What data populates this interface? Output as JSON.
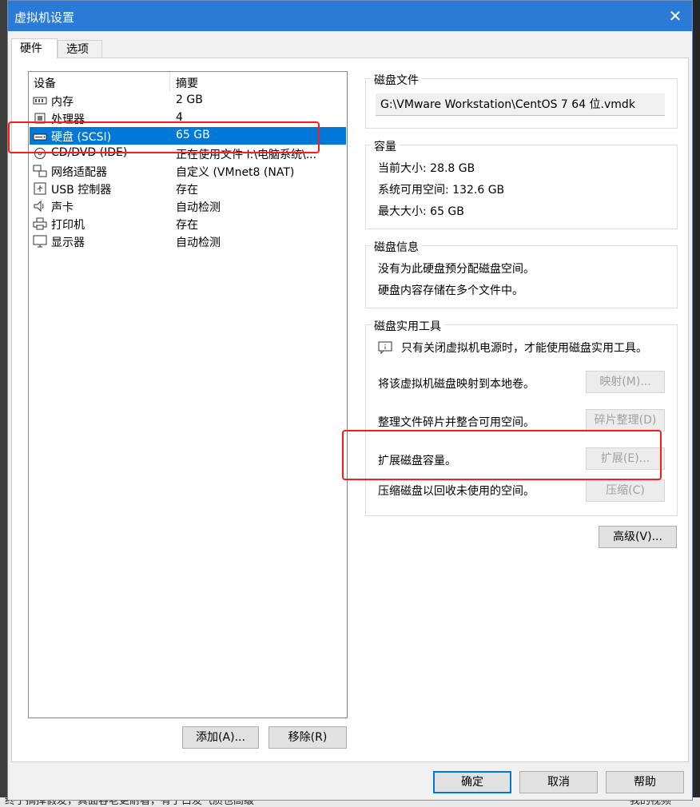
{
  "background": {
    "bottom_left_text": "终于摘掉假发，真面容老更耐看，有了白发气质也高级",
    "bottom_right_text": "我的视频"
  },
  "window": {
    "title": "虚拟机设置",
    "close_icon": "close-icon"
  },
  "tabs": [
    {
      "label": "硬件",
      "active": true
    },
    {
      "label": "选项",
      "active": false
    }
  ],
  "device_list": {
    "col_device": "设备",
    "col_summary": "摘要",
    "items": [
      {
        "icon": "memory-icon",
        "name": "内存",
        "summary": "2 GB"
      },
      {
        "icon": "processor-icon",
        "name": "处理器",
        "summary": "4"
      },
      {
        "icon": "harddisk-icon",
        "name": "硬盘 (SCSI)",
        "summary": "65 GB",
        "selected": true
      },
      {
        "icon": "cd-dvd-icon",
        "name": "CD/DVD (IDE)",
        "summary": "正在使用文件 I:\\电脑系统\\..."
      },
      {
        "icon": "network-adapter-icon",
        "name": "网络适配器",
        "summary": "自定义 (VMnet8 (NAT)"
      },
      {
        "icon": "usb-icon",
        "name": "USB 控制器",
        "summary": "存在"
      },
      {
        "icon": "sound-card-icon",
        "name": "声卡",
        "summary": "自动检测"
      },
      {
        "icon": "printer-icon",
        "name": "打印机",
        "summary": "存在"
      },
      {
        "icon": "display-icon",
        "name": "显示器",
        "summary": "自动检测"
      }
    ],
    "add_button": "添加(A)...",
    "remove_button": "移除(R)"
  },
  "disk_file": {
    "label": "磁盘文件",
    "path": "G:\\VMware Workstation\\CentOS 7 64 位.vmdk"
  },
  "capacity": {
    "label": "容量",
    "current_size": "当前大小: 28.8 GB",
    "system_free": "系统可用空间: 132.6 GB",
    "max_size": "最大大小: 65 GB"
  },
  "disk_info": {
    "label": "磁盘信息",
    "line1": "没有为此硬盘预分配磁盘空间。",
    "line2": "硬盘内容存储在多个文件中。"
  },
  "disk_utilities": {
    "label": "磁盘实用工具",
    "info_icon": "info-message-icon",
    "notice": "只有关闭虚拟机电源时，才能使用磁盘实用工具。",
    "map_text": "将该虚拟机磁盘映射到本地卷。",
    "map_button": "映射(M)...",
    "defrag_text": "整理文件碎片并整合可用空间。",
    "defrag_button": "碎片整理(D)",
    "expand_text": "扩展磁盘容量。",
    "expand_button": "扩展(E)...",
    "compact_text": "压缩磁盘以回收未使用的空间。",
    "compact_button": "压缩(C)"
  },
  "advanced_button": "高级(V)...",
  "footer": {
    "ok": "确定",
    "cancel": "取消",
    "help": "帮助"
  },
  "colors": {
    "titlebar": "#2a7ad6",
    "selection": "#0078d7",
    "highlight": "#ff1a1a"
  }
}
